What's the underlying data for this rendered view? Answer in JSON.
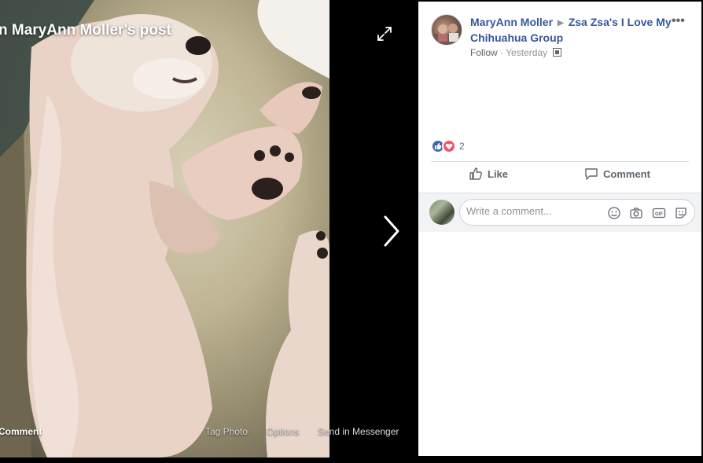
{
  "viewer": {
    "title": "n MaryAnn Moller's post",
    "actions": {
      "comment": "Comment",
      "tag_photo": "Tag Photo",
      "options": "Options",
      "send_in_messenger": "Send in Messenger"
    },
    "icons": [
      "expand-icon",
      "chevron-right-icon"
    ]
  },
  "post": {
    "author": "MaryAnn Moller",
    "group": "Zsa Zsa's I Love My Chihuahua Group",
    "follow_label": "Follow",
    "separator": " · ",
    "timestamp": "Yesterday",
    "more_label": "•••",
    "reaction_count": "2",
    "reactions": [
      "like",
      "love"
    ],
    "like_label": "Like",
    "comment_label": "Comment"
  },
  "composer": {
    "placeholder": "Write a comment...",
    "icons": [
      "emoji-icon",
      "camera-icon",
      "gif-icon",
      "sticker-icon"
    ]
  },
  "colors": {
    "link": "#365899",
    "muted": "#90949c",
    "like_blue": "#4267b2",
    "love_red": "#f25268"
  }
}
